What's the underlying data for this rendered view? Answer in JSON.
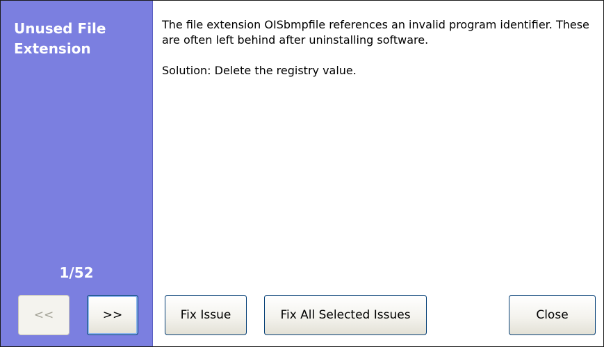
{
  "sidebar": {
    "title": "Unused File Extension",
    "counter": "1/52",
    "prev_label": "<<",
    "next_label": ">>"
  },
  "issue": {
    "description": "The file extension OISbmpfile references an invalid program identifier. These are often left behind after uninstalling software.",
    "solution": "Solution: Delete the registry value."
  },
  "actions": {
    "fix_issue_label": "Fix Issue",
    "fix_all_label": "Fix All Selected Issues",
    "close_label": "Close"
  },
  "colors": {
    "sidebar_bg": "#7b7fe0",
    "button_border": "#003c74"
  }
}
